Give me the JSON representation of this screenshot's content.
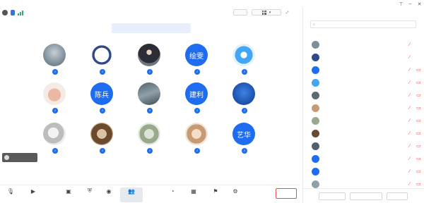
{
  "window": {
    "title": ""
  },
  "toolbar_top": {
    "view_label": "",
    "layout_label": ""
  },
  "notice": {
    "text": ""
  },
  "participants": [
    {
      "name": "",
      "avatar_text": ""
    },
    {
      "name": "",
      "avatar_text": ""
    },
    {
      "name": "",
      "avatar_text": ""
    },
    {
      "name": "",
      "avatar_text": "绘雯"
    },
    {
      "name": "",
      "avatar_text": ""
    },
    {
      "name": "",
      "avatar_text": ""
    },
    {
      "name": "",
      "avatar_text": "陈兵"
    },
    {
      "name": "",
      "avatar_text": ""
    },
    {
      "name": "",
      "avatar_text": "建利"
    },
    {
      "name": "",
      "avatar_text": ""
    },
    {
      "name": "",
      "avatar_text": ""
    },
    {
      "name": "",
      "avatar_text": ""
    },
    {
      "name": "",
      "avatar_text": ""
    },
    {
      "name": "",
      "avatar_text": ""
    },
    {
      "name": "",
      "avatar_text": "艺华"
    }
  ],
  "self_view": {
    "label": ""
  },
  "bottom_bar": {
    "items": [
      {
        "label": "",
        "icon": "mic-icon"
      },
      {
        "label": "",
        "icon": "camera-icon"
      },
      {
        "label": "",
        "icon": "screen-share-icon"
      },
      {
        "label": "",
        "icon": "security-icon"
      },
      {
        "label": "",
        "icon": "record-icon"
      },
      {
        "label": "",
        "icon": "members-icon"
      },
      {
        "label": "",
        "icon": "chat-icon"
      },
      {
        "label": "",
        "icon": "apps-icon"
      },
      {
        "label": "",
        "icon": "interact-icon"
      },
      {
        "label": "",
        "icon": "settings-icon"
      }
    ],
    "leave_label": ""
  },
  "panel": {
    "title": "",
    "search_placeholder": "",
    "members": [
      {
        "name": "",
        "avatar_text": ""
      },
      {
        "name": "",
        "avatar_text": ""
      },
      {
        "name": "",
        "avatar_text": ""
      },
      {
        "name": "",
        "avatar_text": ""
      },
      {
        "name": "",
        "avatar_text": ""
      },
      {
        "name": "",
        "avatar_text": ""
      },
      {
        "name": "",
        "avatar_text": ""
      },
      {
        "name": "",
        "avatar_text": ""
      },
      {
        "name": "",
        "avatar_text": ""
      },
      {
        "name": "",
        "avatar_text": ""
      },
      {
        "name": "",
        "avatar_text": ""
      },
      {
        "name": "",
        "avatar_text": ""
      }
    ],
    "footer_buttons": [
      {
        "label": ""
      },
      {
        "label": ""
      },
      {
        "label": ""
      }
    ]
  },
  "colors": {
    "accent": "#1e6cf0",
    "danger": "#e34d4d",
    "notice_bg": "#e8eefc"
  }
}
